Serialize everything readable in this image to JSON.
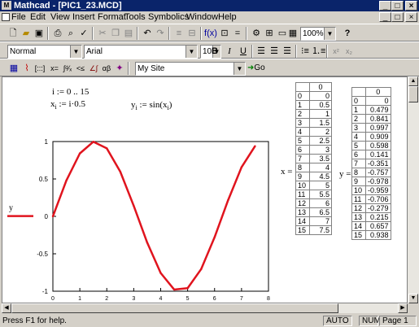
{
  "window": {
    "title": "Mathcad - [PIC1_23.MCD]",
    "app_icon": "mathcad-icon"
  },
  "window_controls": {
    "minimize": "_",
    "maximize": "□",
    "close": "×"
  },
  "menu": [
    "File",
    "Edit",
    "View",
    "Insert",
    "Format",
    "Tools",
    "Symbolics",
    "Window",
    "Help"
  ],
  "format_bar": {
    "style": "Normal",
    "font": "Arial",
    "size": "10",
    "bold": "B",
    "italic": "I",
    "underline": "U"
  },
  "standard_bar": {
    "zoom": "100%",
    "help": "?"
  },
  "math_bar": {
    "resource": "My Site",
    "go": "Go"
  },
  "worksheet": {
    "range_def": "i := 0 .. 15",
    "x_def_lhs": "x",
    "x_def_sub": "i",
    "x_def_rhs": ":= i·0.5",
    "y_def_lhs": "y",
    "y_def_sub": "i",
    "y_def_rhs": ":= sin(x",
    "y_def_rhs_sub": "i",
    "y_def_rhs_close": ")",
    "x_label": "x =",
    "y_label": "y ="
  },
  "chart_data": {
    "type": "line",
    "x": [
      0,
      0.5,
      1,
      1.5,
      2,
      2.5,
      3,
      3.5,
      4,
      4.5,
      5,
      5.5,
      6,
      6.5,
      7,
      7.5
    ],
    "series": [
      {
        "name": "y",
        "values": [
          0,
          0.479,
          0.841,
          0.997,
          0.909,
          0.598,
          0.141,
          -0.351,
          -0.757,
          -0.978,
          -0.959,
          -0.706,
          -0.279,
          0.215,
          0.657,
          0.938
        ],
        "color": "#e0141e"
      }
    ],
    "xlim": [
      0,
      8
    ],
    "ylim": [
      -1,
      1
    ],
    "x_ticks": [
      "0",
      "1",
      "2",
      "3",
      "4",
      "5",
      "6",
      "7",
      "8"
    ],
    "y_ticks": [
      "1",
      "0.5",
      "0",
      "-0.5",
      "-1"
    ]
  },
  "x_table": {
    "header": "0",
    "rows": [
      [
        "0",
        "0"
      ],
      [
        "1",
        "0.5"
      ],
      [
        "2",
        "1"
      ],
      [
        "3",
        "1.5"
      ],
      [
        "4",
        "2"
      ],
      [
        "5",
        "2.5"
      ],
      [
        "6",
        "3"
      ],
      [
        "7",
        "3.5"
      ],
      [
        "8",
        "4"
      ],
      [
        "9",
        "4.5"
      ],
      [
        "10",
        "5"
      ],
      [
        "11",
        "5.5"
      ],
      [
        "12",
        "6"
      ],
      [
        "13",
        "6.5"
      ],
      [
        "14",
        "7"
      ],
      [
        "15",
        "7.5"
      ]
    ]
  },
  "y_table": {
    "header": "0",
    "rows": [
      [
        "0",
        "0"
      ],
      [
        "1",
        "0.479"
      ],
      [
        "2",
        "0.841"
      ],
      [
        "3",
        "0.997"
      ],
      [
        "4",
        "0.909"
      ],
      [
        "5",
        "0.598"
      ],
      [
        "6",
        "0.141"
      ],
      [
        "7",
        "-0.351"
      ],
      [
        "8",
        "-0.757"
      ],
      [
        "9",
        "-0.978"
      ],
      [
        "10",
        "-0.959"
      ],
      [
        "11",
        "-0.706"
      ],
      [
        "12",
        "-0.279"
      ],
      [
        "13",
        "0.215"
      ],
      [
        "14",
        "0.657"
      ],
      [
        "15",
        "0.938"
      ]
    ]
  },
  "status": {
    "help": "Press F1 for help.",
    "mode": "AUTO",
    "num": "NUM",
    "page": "Page 1"
  }
}
